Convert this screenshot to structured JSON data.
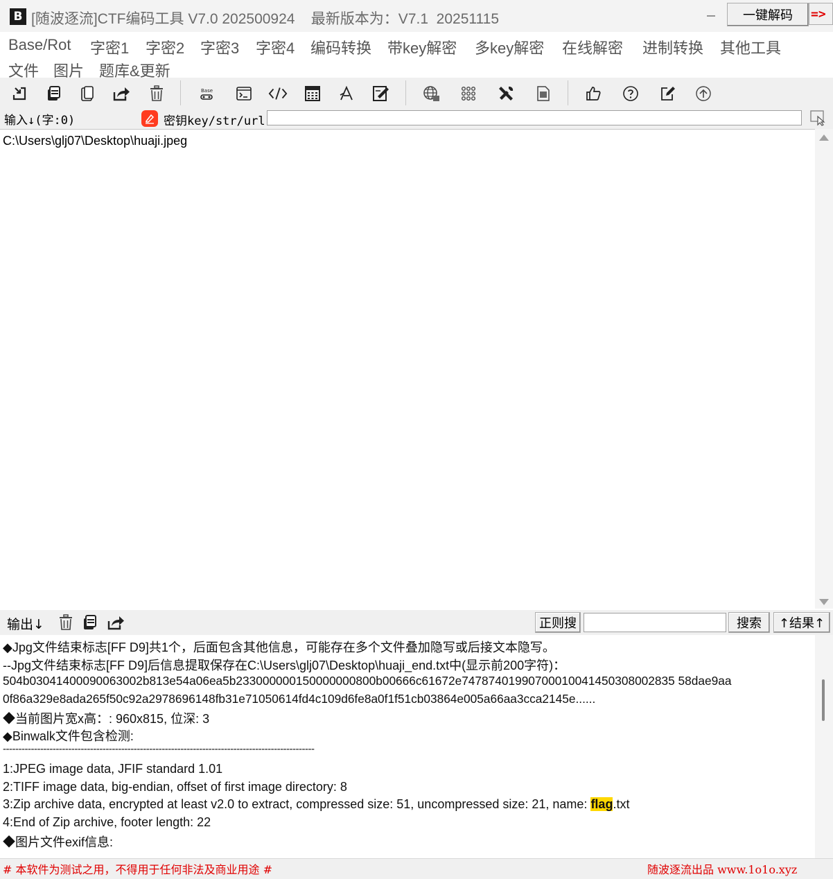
{
  "window": {
    "logo_text": "B",
    "title": "[随波逐流]CTF编码工具 V7.0 202500924    最新版本为：V7.1  20251115"
  },
  "menu": {
    "row1": [
      "Base/Rot",
      "字密1",
      "字密2",
      "字密3",
      "字密4",
      "编码转换",
      "带key解密",
      "多key解密",
      "在线解密",
      "进制转换",
      "其他工具"
    ],
    "row2": [
      "文件",
      "图片",
      "题库&更新"
    ]
  },
  "toolbar": {
    "icons": [
      "import-icon",
      "copy-icon",
      "paste-icon",
      "share-icon",
      "trash-icon",
      "encode-icon",
      "terminal-icon",
      "code-icon",
      "calculator-icon",
      "font-icon",
      "edit-box-icon",
      "globe-icon",
      "grid-icon",
      "tools-icon",
      "document-icon",
      "thumbs-up-icon",
      "help-icon",
      "edit-icon",
      "upgrade-icon"
    ],
    "decode_label": "一键解码",
    "arrow_label": "=>"
  },
  "input_bar": {
    "label": "输入↓(字:0)",
    "key_label": "密钥key/str/url:",
    "key_value": ""
  },
  "input": {
    "text": "C:\\Users\\glj07\\Desktop\\huaji.jpeg"
  },
  "output_bar": {
    "label": "输出↓",
    "regex_label": "正则搜",
    "search_value": "",
    "search_label": "搜索",
    "result_label": "↑结果↑"
  },
  "output": {
    "lines": [
      "◆Jpg文件结束标志[FF D9]共1个，后面包含其他信息，可能存在多个文件叠加隐写或后接文本隐写。",
      "--Jpg文件结束标志[FF D9]后信息提取保存在C:\\Users\\glj07\\Desktop\\huaji_end.txt中(显示前200字符)：",
      "504b03041400090063002b813e54a06ea5b233000000150000000800b00666c61672e74787401990700010041450308002835 58dae9aa",
      "0f86a329e8ada265f50c92a2978696148fb31e71050614fd4c109d6fe8a0f1f51cb03864e005a66aa3cca2145e......",
      "◆当前图片宽x高：: 960x815, 位深: 3",
      "◆Binwalk文件包含检测:",
      "----------------------------------------------------------------------------------------------------",
      "1:JPEG image data, JFIF standard 1.01",
      "2:TIFF image data, big-endian, offset of first image directory: 8"
    ],
    "zip_line_prefix": "3:Zip archive data, encrypted at least v2.0 to extract, compressed size: 51, uncompressed size: 21, name: ",
    "zip_highlight": "flag",
    "zip_line_suffix": ".txt",
    "tail_lines": [
      "4:End of Zip archive, footer length: 22",
      "◆图片文件exif信息:"
    ]
  },
  "status": {
    "left": "# 本软件为测试之用，不得用于任何非法及商业用途 #",
    "right": "随波逐流出品 www.1o1o.xyz"
  },
  "colors": {
    "highlight": "#ffd800",
    "status_red": "#e00000",
    "toolbar_bg": "#f0f0f0"
  }
}
